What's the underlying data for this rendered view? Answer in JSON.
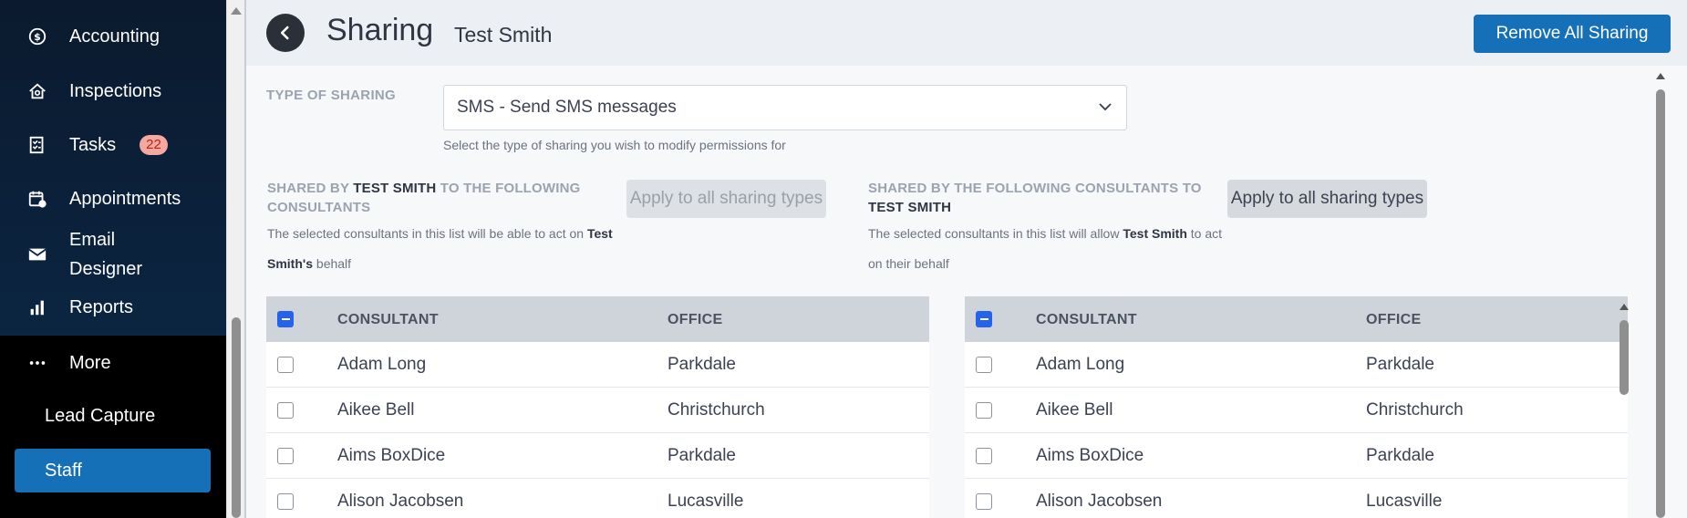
{
  "sidebar": {
    "items": [
      {
        "label": "Accounting",
        "icon": "dollar-circle-icon"
      },
      {
        "label": "Inspections",
        "icon": "home-search-icon"
      },
      {
        "label": "Tasks",
        "icon": "checklist-icon",
        "badge": "22"
      },
      {
        "label": "Appointments",
        "icon": "calendar-clock-icon"
      },
      {
        "label": "Email Designer",
        "icon": "envelope-icon"
      },
      {
        "label": "Reports",
        "icon": "bar-chart-icon"
      },
      {
        "label": "More",
        "icon": "ellipsis-icon"
      }
    ],
    "sub_items": [
      {
        "label": "Lead Capture",
        "active": false
      },
      {
        "label": "Staff",
        "active": true
      }
    ]
  },
  "header": {
    "title": "Sharing",
    "subtitle": "Test Smith",
    "remove_all_label": "Remove All Sharing"
  },
  "type_of_sharing": {
    "label": "TYPE OF SHARING",
    "selected": "SMS - Send SMS messages",
    "helper": "Select the type of sharing you wish to modify permissions for"
  },
  "left_section": {
    "heading_pre": "SHARED BY",
    "heading_name": "TEST SMITH",
    "heading_post": "TO THE FOLLOWING CONSULTANTS",
    "desc_pre": "The selected consultants in this list will be able to act on",
    "desc_name": "Test Smith's",
    "desc_post": "behalf",
    "apply_label": "Apply to all sharing types"
  },
  "right_section": {
    "heading_pre": "SHARED BY THE FOLLOWING CONSULTANTS TO",
    "heading_name": "TEST SMITH",
    "desc_pre": "The selected consultants in this list will allow",
    "desc_name": "Test Smith",
    "desc_post": "to act on their behalf",
    "apply_label": "Apply to all sharing types"
  },
  "table": {
    "col_consultant": "CONSULTANT",
    "col_office": "OFFICE",
    "rows": [
      {
        "consultant": "Adam Long",
        "office": "Parkdale"
      },
      {
        "consultant": "Aikee Bell",
        "office": "Christchurch"
      },
      {
        "consultant": "Aims BoxDice",
        "office": "Parkdale"
      },
      {
        "consultant": "Alison Jacobsen",
        "office": "Lucasville"
      }
    ]
  },
  "colors": {
    "accent": "#1670b8",
    "checkbox_accent": "#2563eb",
    "sidebar_bg": "#0b1a2e",
    "badge_bg": "#f3a8a0"
  }
}
